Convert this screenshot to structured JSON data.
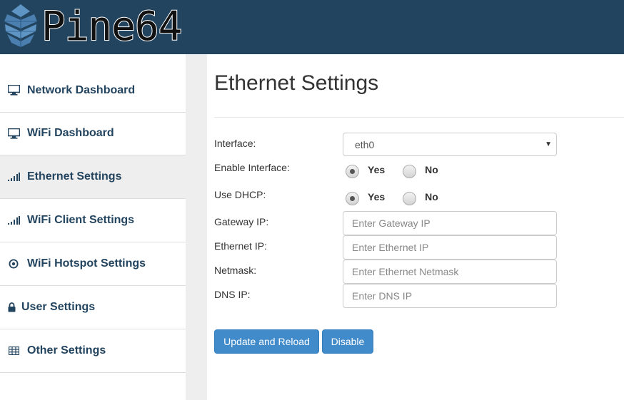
{
  "header": {
    "brand": "Pine64",
    "logo_icon": "pinecone-icon"
  },
  "sidebar": {
    "items": [
      {
        "label": "Network Dashboard",
        "icon": "monitor-icon"
      },
      {
        "label": "WiFi Dashboard",
        "icon": "monitor-icon"
      },
      {
        "label": "Ethernet Settings",
        "icon": "signal-bars-icon",
        "active": true
      },
      {
        "label": "WiFi Client Settings",
        "icon": "signal-bars-icon"
      },
      {
        "label": "WiFi Hotspot Settings",
        "icon": "target-icon"
      },
      {
        "label": "User Settings",
        "icon": "lock-icon"
      },
      {
        "label": "Other Settings",
        "icon": "table-icon"
      }
    ]
  },
  "main": {
    "title": "Ethernet Settings",
    "interface": {
      "label": "Interface:",
      "value": "eth0"
    },
    "enable_interface": {
      "label": "Enable Interface:",
      "yes": "Yes",
      "no": "No",
      "selected": "Yes"
    },
    "use_dhcp": {
      "label": "Use DHCP:",
      "yes": "Yes",
      "no": "No",
      "selected": "Yes"
    },
    "gateway_ip": {
      "label": "Gateway IP:",
      "placeholder": "Enter Gateway IP",
      "value": ""
    },
    "ethernet_ip": {
      "label": "Ethernet IP:",
      "placeholder": "Enter Ethernet IP",
      "value": ""
    },
    "netmask": {
      "label": "Netmask:",
      "placeholder": "Enter Ethernet Netmask",
      "value": ""
    },
    "dns_ip": {
      "label": "DNS IP:",
      "placeholder": "Enter DNS IP",
      "value": ""
    },
    "buttons": {
      "update": "Update and Reload",
      "disable": "Disable"
    }
  },
  "colors": {
    "header_bg": "#23445f",
    "link": "#23445f",
    "primary": "#428bca"
  }
}
